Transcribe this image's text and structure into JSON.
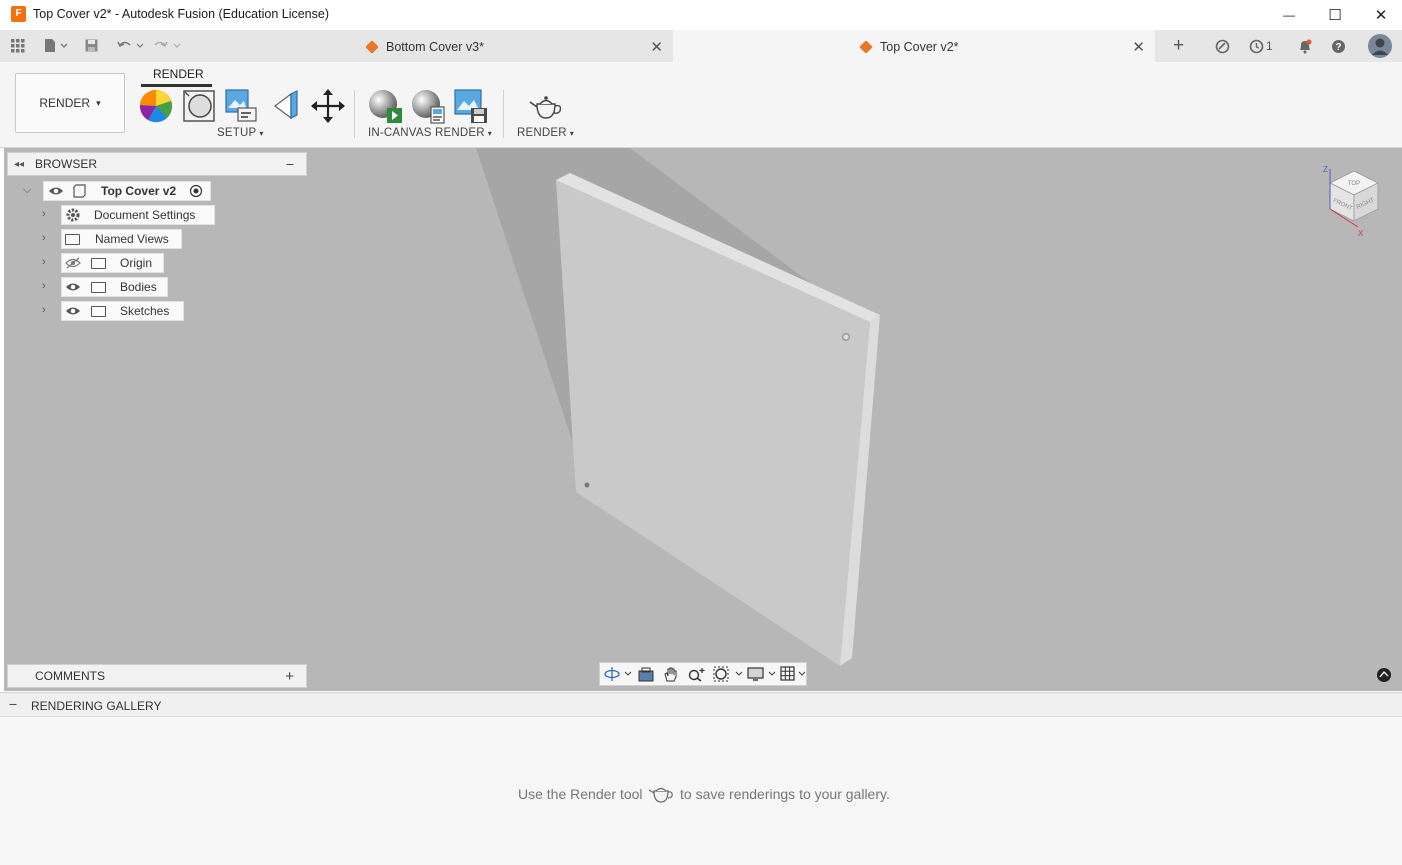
{
  "window": {
    "title": "Top Cover v2* - Autodesk Fusion (Education License)",
    "logo_letter": "F",
    "minimize_glyph": "—",
    "maximize_glyph": "☐",
    "close_glyph": "✕"
  },
  "tabs": [
    {
      "label": "Bottom Cover v3*",
      "active": false
    },
    {
      "label": "Top Cover v2*",
      "active": true
    }
  ],
  "tabbar_right": {
    "add_glyph": "+",
    "jobs_count": "1"
  },
  "toolbar": {
    "workspace_label": "RENDER",
    "workspace_tab": "RENDER",
    "groups": {
      "setup": "SETUP",
      "in_canvas": "IN-CANVAS RENDER",
      "render": "RENDER"
    },
    "dropdown_glyph": "▾"
  },
  "browser": {
    "title": "BROWSER",
    "collapse_glyph": "−",
    "root": "Top Cover v2",
    "items": [
      {
        "label": "Document Settings"
      },
      {
        "label": "Named Views"
      },
      {
        "label": "Origin"
      },
      {
        "label": "Bodies"
      },
      {
        "label": "Sketches"
      }
    ]
  },
  "comments": {
    "title": "COMMENTS",
    "add_glyph": "+"
  },
  "viewcube": {
    "top_face": "TOP",
    "front_face": "FRONT",
    "right_face": "RIGHT",
    "axis_z": "Z",
    "axis_x": "X"
  },
  "gallery": {
    "title": "RENDERING GALLERY",
    "collapse_glyph": "−",
    "message_before": "Use the Render tool",
    "message_after": "to save renderings to your gallery."
  },
  "colors": {
    "viewport_bg": "#b7b7b7",
    "accent_orange": "#e8772a",
    "toolbar_bg": "#f5f5f5"
  }
}
